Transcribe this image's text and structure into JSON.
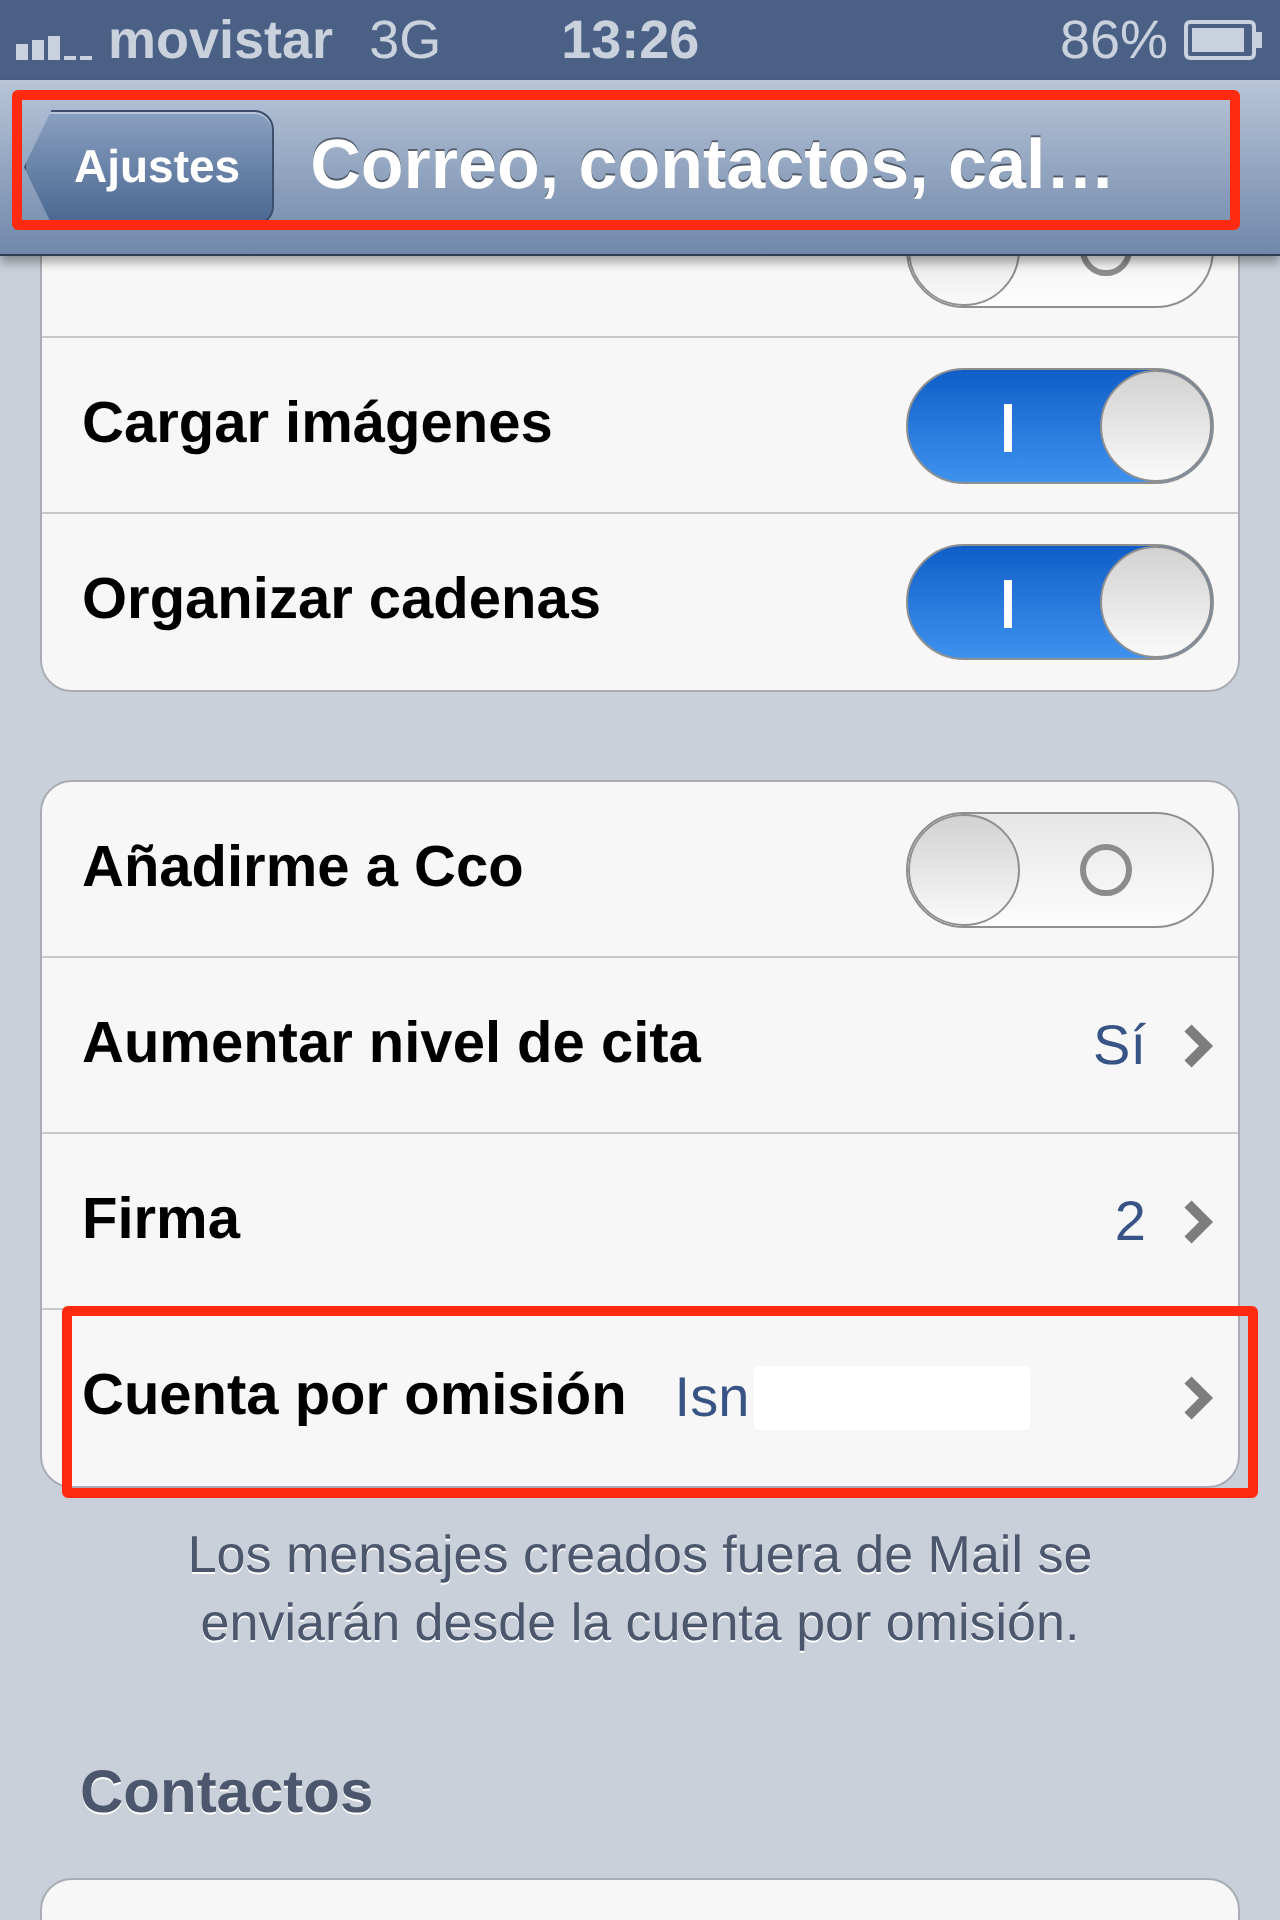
{
  "status_bar": {
    "carrier": "movistar",
    "network": "3G",
    "time": "13:26",
    "battery": "86%"
  },
  "nav_bar": {
    "back": "Ajustes",
    "title": "Correo, contactos, cal…",
    "highlighted": true
  },
  "groups": [
    {
      "rows": [
        {
          "kind": "toggle",
          "on": false
        },
        {
          "kind": "toggle",
          "label": "Cargar imágenes",
          "on": true
        },
        {
          "kind": "toggle",
          "label": "Organizar cadenas",
          "on": true
        }
      ]
    },
    {
      "rows": [
        {
          "kind": "toggle",
          "label": "Añadirme a Cco",
          "on": false
        },
        {
          "kind": "detail",
          "label": "Aumentar nivel de cita",
          "value": "Sí"
        },
        {
          "kind": "detail",
          "label": "Firma",
          "value": "2"
        },
        {
          "kind": "detail",
          "label": "Cuenta por omisión",
          "value": "Isn",
          "redacted": true,
          "highlighted": true
        }
      ],
      "footer": "Los mensajes creados fuera de Mail se enviarán desde la cuenta por omisión."
    }
  ],
  "section_header": "Contactos"
}
